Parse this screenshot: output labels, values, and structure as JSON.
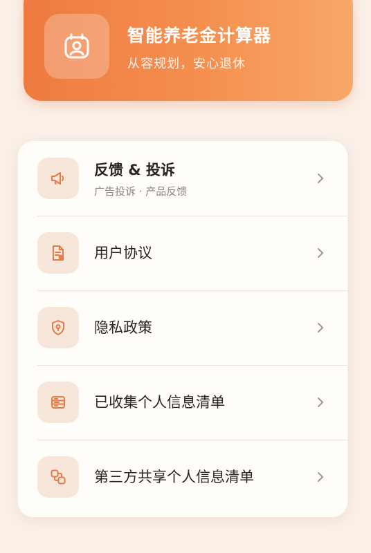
{
  "header": {
    "title": "智能养老金计算器",
    "subtitle": "从容规划，安心退休",
    "icon": "calendar-person-icon"
  },
  "menu": {
    "items": [
      {
        "title": "反馈 & 投诉",
        "subtitle": "广告投诉 · 产品反馈",
        "icon": "megaphone-icon"
      },
      {
        "title": "用户协议",
        "icon": "document-icon"
      },
      {
        "title": "隐私政策",
        "icon": "shield-icon"
      },
      {
        "title": "已收集个人信息清单",
        "icon": "list-icon"
      },
      {
        "title": "第三方共享个人信息清单",
        "icon": "share-icon"
      }
    ]
  },
  "colors": {
    "accent": "#ee7a40",
    "icon_bg": "#f7e6da",
    "icon_fg": "#e47a45",
    "background": "#faf0e8"
  }
}
